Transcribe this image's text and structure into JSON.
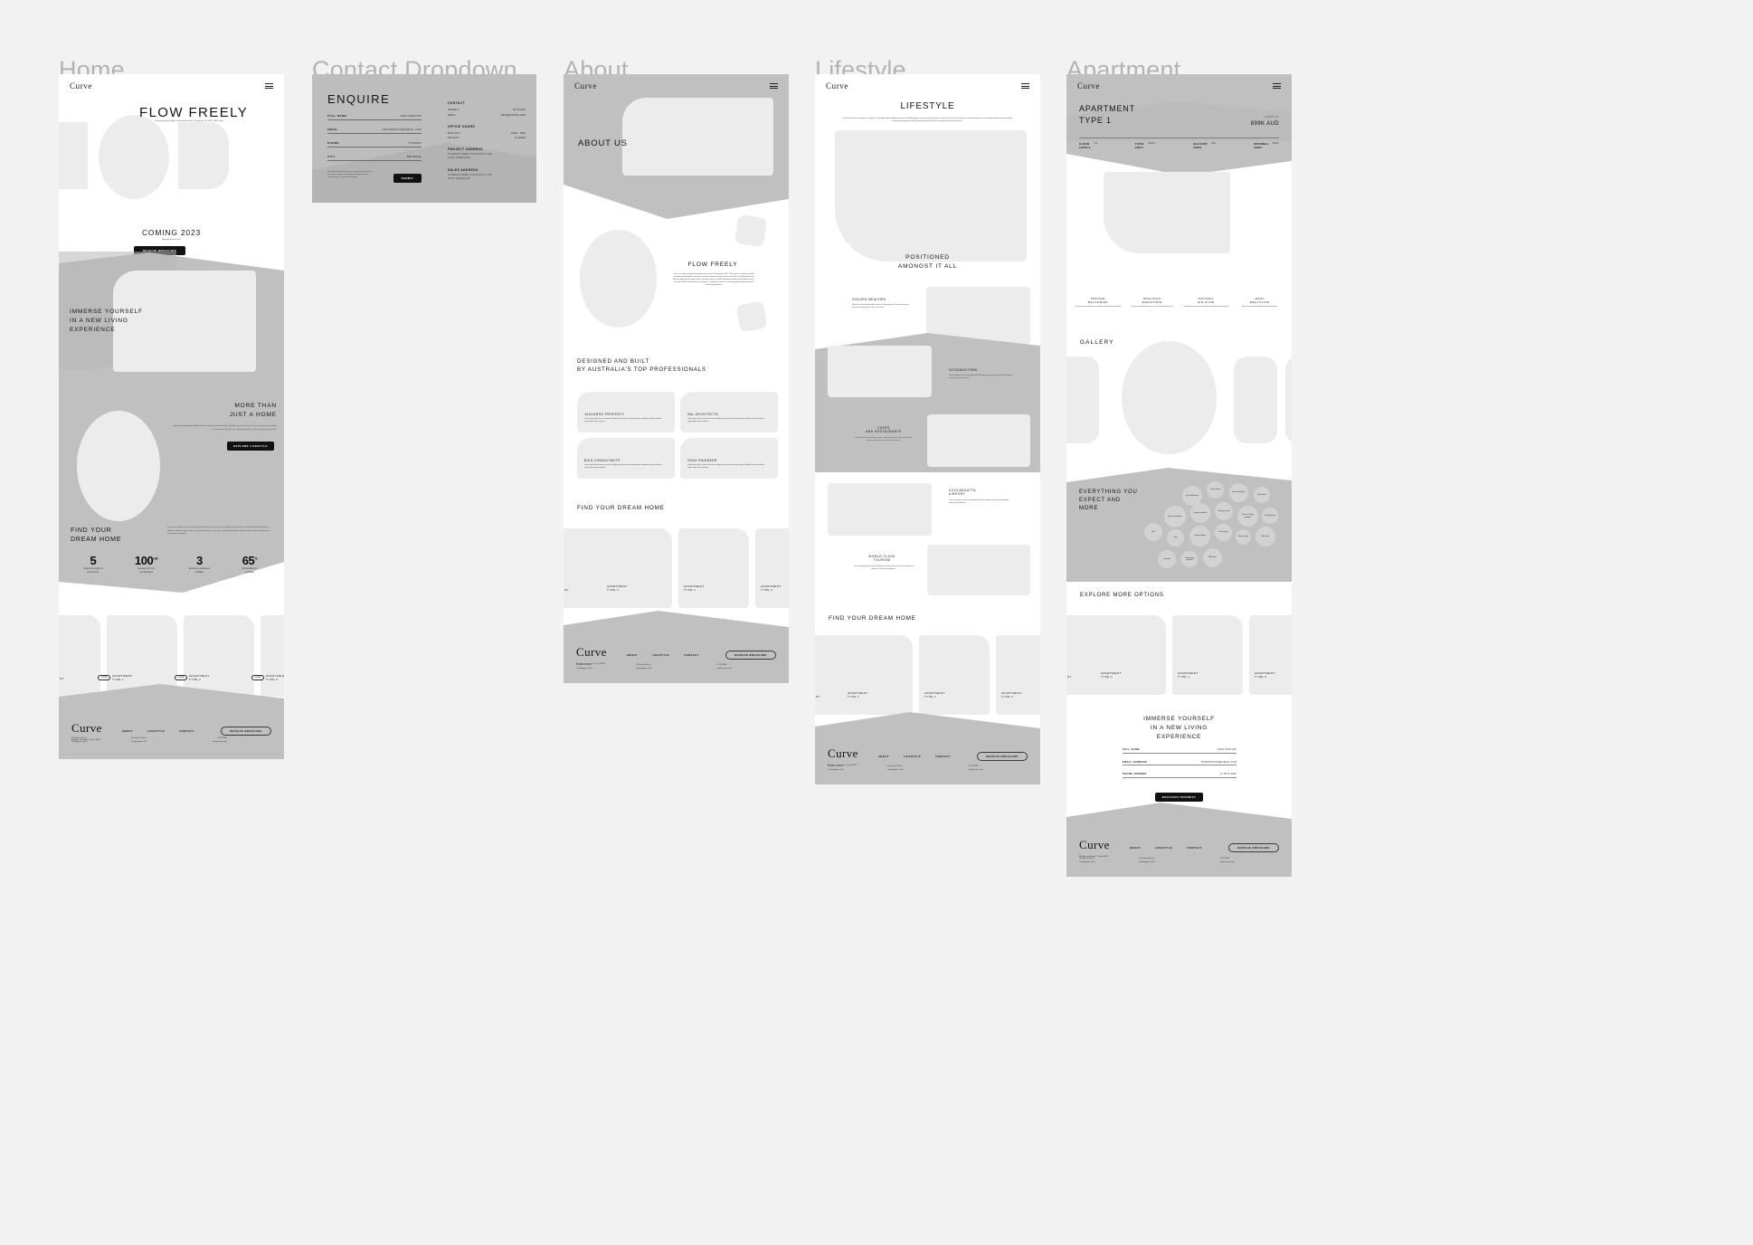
{
  "board": {
    "background": "#f2f2f2",
    "frames": [
      "Home",
      "Contact Dropdown",
      "About",
      "Lifestyle",
      "Apartment"
    ]
  },
  "titles": {
    "home": "Home",
    "contact": "Contact Dropdown",
    "about": "About",
    "lifestyle": "Lifestyle",
    "apartment": "Apartment"
  },
  "brand": "Curve",
  "home": {
    "hero_title": "FLOW FREELY",
    "hero_sub": "Generously sized indoor and outdoor living. Coming soon to 2023, Gold Coast.",
    "coming": "COMING 2023",
    "coming_sub": "Register interest now",
    "cta_brochure": "RECEIVE BROCHURE",
    "immerse": "IMMERSE YOURSELF\nIN A NEW LIVING\nEXPERIENCE",
    "more_than": "MORE THAN\nJUST A HOME",
    "more_body": "Specifically designed for Australia's pristine beachside lifestyle. Whether you're looking for a new permanent tranquility or a weekend escape, this refined experience will accompany you for life.",
    "cta_lifestyle": "EXPLORE LIFESTYLE",
    "find_title": "FIND YOUR\nDREAM HOME",
    "find_body": "Lorem ipsum dolor sit amet consectetur. Risus purus consectetur adipiscing elit sed do eiusmod tempor incididunt ut labore et dolore magna aliqua. Ut enim ad minim veniam quis nostrud exercitation ullamco laboris nisi ut aliquip ex ea commodo consequat.",
    "stats": [
      {
        "value": "5",
        "unit": "",
        "caption": "Unique floor plans to\nchoose from"
      },
      {
        "value": "100",
        "unit": "m2",
        "caption": "Average floor size\nper apartment"
      },
      {
        "value": "3",
        "unit": "",
        "caption": "Exclusive penthouses\navailable"
      },
      {
        "value": "65",
        "unit": "%",
        "caption": "Still available for\npurchase"
      }
    ],
    "cards": [
      "APARTMENT\nTYPE 1",
      "APARTMENT\nTYPE 2",
      "APARTMENT\nTYPE 3"
    ],
    "card_cta": "VIEW"
  },
  "contact": {
    "title": "ENQUIRE",
    "fields": [
      {
        "label": "FULL NAME",
        "value": "JOHN HOPKINS"
      },
      {
        "label": "EMAIL",
        "value": "JOHNHOPKINS@GMAIL.COM"
      },
      {
        "label": "PHONE",
        "value": "37593084"
      },
      {
        "label": "CITY",
        "value": "BRISBANE"
      }
    ],
    "disclaimer": "By submitting your details, you consent to be contacted\nby Curve in relation to this project. Please read our\nprivacy policy for specific information.",
    "submit": "SUBMIT",
    "contact_head": "CONTACT",
    "contact_rows": [
      {
        "k": "PHONE 1",
        "v": "32 572345"
      },
      {
        "k": "EMAIL",
        "v": "INFO@CURVE.COM"
      }
    ],
    "hours_head": "OFFICE HOURS",
    "hours_rows": [
      {
        "k": "MON-THU",
        "v": "10AM - 5PM"
      },
      {
        "k": "FRI-SUN",
        "v": "CLOSED"
      }
    ],
    "project_head": "PROJECT ADDRESS",
    "project_addr": "29 GARRICK STREET, COOLANGATTA, GOLD\nCOAST, QUEENSLAND",
    "sales_head": "SALES ADDRESS",
    "sales_addr": "42 GARRICK STREET, COOLANGATTA, GOLD\nCOAST, QUEENSLAND"
  },
  "about": {
    "hero_title": "ABOUT US",
    "flow_title": "FLOW FREELY",
    "flow_body": "Curve is a unique property development in the heart of Coolangatta QLD. The project is a modern upmarket development designed for spacious and low maintenance living within a short walk of all of Australia's top beaches. Although the project doesn't have beachfront it is perfectly positioned adjacent to parklands and is peaceful and free from elements ensuring that residents can make use of their gorgeous landscaped and entertaining balconies.",
    "designed_title": "DESIGNED AND BUILT\nBY AUSTRALIA'S TOP PROFESSIONALS",
    "partners": [
      {
        "name": "JACKAROO PROPERTY",
        "body": "Lorem ipsum dolor sit amet consectetur adipiscing elit sed do eiusmod tempor incididunt ut labore et dolore magna aliqua enim ad minim."
      },
      {
        "name": "HAL ARCHITECTS",
        "body": "Lorem ipsum dolor sit amet consectetur adipiscing elit sed do eiusmod tempor incididunt ut labore et dolore magna aliqua enim ad minim."
      },
      {
        "name": "BICA CONSULTANTS",
        "body": "Lorem ipsum dolor sit amet consectetur adipiscing elit sed do eiusmod tempor incididunt ut labore et dolore magna aliqua enim ad minim."
      },
      {
        "name": "OSKA ENGINEER",
        "body": "Lorem ipsum dolor sit amet consectetur adipiscing elit sed do eiusmod tempor incididunt ut labore et dolore magna aliqua enim ad minim."
      }
    ],
    "find_title": "FIND YOUR DREAM HOME",
    "cards": [
      "APARTMENT\nTYPE 1",
      "APARTMENT\nTYPE 1",
      "APARTMENT\nTYPE 3"
    ]
  },
  "lifestyle": {
    "hero_title": "LIFESTYLE",
    "hero_body": "This brand new Curve apartment complex in Coolangatta offers magnificent views, beautiful lifestyle and access to an abundance of amenities. For those looking to immerse themselves in a relaxed coastal environment whilst having everything they could ever possibly need, then this is the perfect place to settle down.",
    "positioned": "POSITIONED\nAMONGST IT ALL",
    "features": [
      {
        "name": "GOLDEN BEACHES",
        "body": "Minutes from the pristine golden sands of Coolangatta and Greenmount beach, perfect for morning swims and sunset walks."
      },
      {
        "name": "GOODWIN PARK",
        "body": "Directly adjacent to lush green parklands offering open space, playgrounds and walking tracks right at your doorstep."
      },
      {
        "name": "CAFES\nAND RESTAURANTS",
        "body": "A vibrant hub of award winning cafes, restaurants and bars within easy walking distance, catering for every taste and occasion."
      },
      {
        "name": "COOLANGATTA\nAIRPORT",
        "body": "Only a short drive to Gold Coast Airport with direct domestic and international flights, making travel effortless."
      },
      {
        "name": "WORLD CLASS\nTOURISM",
        "body": "Surrounded by world renowned attractions, theme parks and natural wonders that define the Gold Coast experience."
      }
    ],
    "find_title": "FIND YOUR DREAM HOME",
    "cards": [
      "APARTMENT\nTYPE 1",
      "APARTMENT\nTYPE 1",
      "APARTMENT\nTYPE 3"
    ]
  },
  "apartment": {
    "title": "APARTMENT\nTYPE 1",
    "starts_label": "STARTS AT",
    "price": "899K AUD",
    "specs": [
      {
        "k": "FLOOR\nLEVELS",
        "v": "2-6"
      },
      {
        "k": "TOTAL\nAREA",
        "v": "116.6m²"
      },
      {
        "k": "BALCONY\nAREA",
        "v": "28m²"
      },
      {
        "k": "INTERNAL\nAREA",
        "v": "80.6m²"
      }
    ],
    "features": [
      {
        "name": "PRIVATE\nBALCONIES",
        "body": "Generous oversized balconies included, separated by privacy walls."
      },
      {
        "name": "SPACIOUS\nELEVATORS",
        "body": "2 express oversized lifts to service 14 and 15 apartments each."
      },
      {
        "name": "NATURAL\nAIR FLOW",
        "body": "Designed for natural air flow through each apartment (breeze way)."
      },
      {
        "name": "EASY\nRECYCLING",
        "body": "Bin chutes located inside floor for separated waste."
      }
    ],
    "gallery_title": "GALLERY",
    "everything_title": "EVERYTHING YOU\nEXPECT AND\nMORE",
    "bubbles": [
      "Air conditioning",
      "Gas cooking",
      "Stone benchtops",
      "Dishwasher",
      "Built in wardrobes",
      "Ducted ventilation",
      "Security access",
      "Floor to ceiling windows",
      "Timber flooring",
      "Pool",
      "Gym",
      "Visitor parking",
      "EV charging",
      "Storage cage",
      "Bike racks",
      "Intercom",
      "Landscaped gardens",
      "BBQ area"
    ],
    "explore_title": "EXPLORE MORE OPTIONS",
    "cards": [
      "APARTMENT\nTYPE 1",
      "APARTMENT\nTYPE 1",
      "APARTMENT\nTYPE 3"
    ],
    "immerse_title": "IMMERSE YOURSELF\nIN A NEW LIVING\nEXPERIENCE",
    "form": [
      {
        "label": "FULL NAME",
        "value": "JOHN HOPKINS"
      },
      {
        "label": "EMAIL ADDRESS",
        "value": "JOHNHOPKINS@GMAIL.COM"
      },
      {
        "label": "PHONE NUMBER",
        "value": "11 5678 9000"
      }
    ],
    "register": "REGISTER INTEREST"
  },
  "footer": {
    "brand": "Curve",
    "links": [
      "ABOUT",
      "LIFESTYLE",
      "CONTACT"
    ],
    "cta": "RECEIVE BROCHURE",
    "copyright": "All rights reserved © Curve 2023",
    "addr_head": "Project Address",
    "addr": "29 Garrick Street\nCoolangatta, QLD",
    "sales_head": "Sales Address",
    "sales": "42 Garrick Street\nCoolangatta, QLD",
    "contact_head": "Contact",
    "contact": "32 572345\ninfo@curve.com"
  }
}
